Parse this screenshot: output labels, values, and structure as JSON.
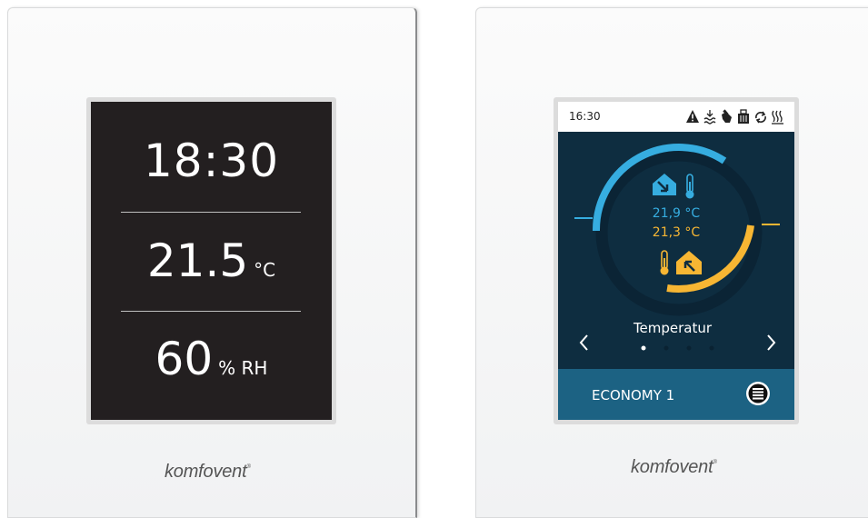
{
  "left_device": {
    "time": "18:30",
    "temperature_value": "21.5",
    "temperature_unit": "°C",
    "humidity_value": "60",
    "humidity_unit": "% RH",
    "brand": "komfovent",
    "brand_mark": "®"
  },
  "right_device": {
    "status_time": "16:30",
    "status_icons": [
      "warning-icon",
      "water-heater-icon",
      "hand-icon",
      "filter-icon",
      "sync-icon",
      "heating-icon"
    ],
    "supply_temperature": "21,9 °C",
    "extract_temperature": "21,3 °C",
    "page_label": "Temperatur",
    "page_indicator": {
      "count": 4,
      "active": 1
    },
    "mode_label": "ECONOMY 1",
    "brand": "komfovent",
    "brand_mark": "®",
    "colors": {
      "supply": "#36ade0",
      "extract": "#f7b633",
      "screen_bg": "#0e2d40",
      "bottom_bar": "#1c6283"
    }
  }
}
